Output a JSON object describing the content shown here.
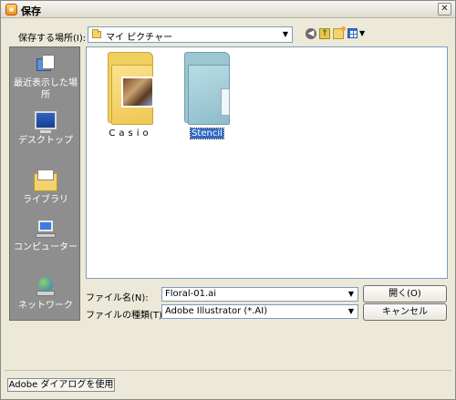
{
  "window": {
    "title": "保存",
    "close_glyph": "✕"
  },
  "toolbar": {
    "lookin_label": "保存する場所(I):",
    "lookin_value": "マイ ピクチャー",
    "dropdown_glyph": "▼",
    "back_glyph": "◀",
    "up_glyph": "↑"
  },
  "places": [
    {
      "label": "最近表示した場所",
      "icon": "recent-places-icon"
    },
    {
      "label": "デスクトップ",
      "icon": "desktop-icon"
    },
    {
      "label": "ライブラリ",
      "icon": "library-icon"
    },
    {
      "label": "コンピューター",
      "icon": "computer-icon"
    },
    {
      "label": "ネットワーク",
      "icon": "network-icon"
    }
  ],
  "files": [
    {
      "name": "Casio",
      "type": "folder",
      "selected": false
    },
    {
      "name": "Stencil",
      "type": "folder",
      "selected": true
    }
  ],
  "form": {
    "filename_label": "ファイル名(N):",
    "filename_value": "Floral-01.ai",
    "filetype_label": "ファイルの種類(T):",
    "filetype_value": "Adobe Illustrator (*.AI)"
  },
  "buttons": {
    "open": "開く(O)",
    "cancel": "キャンセル",
    "adobe_dialog": "Adobe ダイアログを使用"
  },
  "colors": {
    "selection": "#316ac5",
    "places_bg": "#8e8e8e",
    "dialog_bg": "#ece9d8"
  }
}
